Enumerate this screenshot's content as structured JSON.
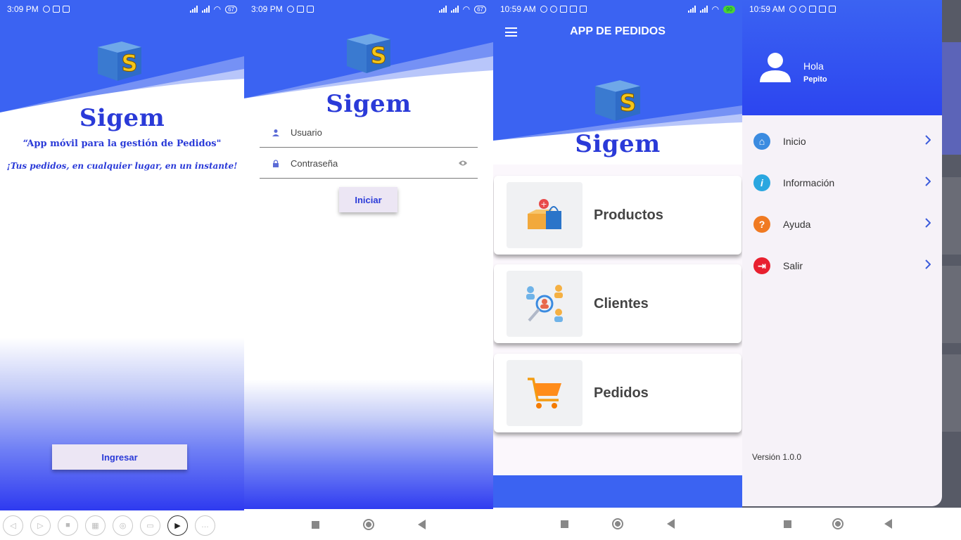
{
  "screen1": {
    "status": {
      "time": "3:09 PM",
      "battery": "67"
    },
    "brand": "Sigem",
    "tagline": "“App móvil para la gestión de Pedidos\"",
    "slogan": "¡Tus pedidos, en cualquier  lugar, en un instante!",
    "button": "Ingresar",
    "toolbar_icons": [
      "back-icon",
      "forward-icon",
      "pen-off-icon",
      "layers-icon",
      "zoom-icon",
      "keyboard-icon",
      "video-icon",
      "more-icon"
    ]
  },
  "screen2": {
    "status": {
      "time": "3:09 PM",
      "battery": "67"
    },
    "brand": "Sigem",
    "username_label": "Usuario",
    "password_label": "Contraseña",
    "button": "Iniciar"
  },
  "screen3": {
    "status": {
      "time": "10:59 AM",
      "battery": "90"
    },
    "appbar_title": "APP DE PEDIDOS",
    "brand": "Sigem",
    "cards": [
      {
        "label": "Productos",
        "icon": "shopping-box-icon"
      },
      {
        "label": "Clientes",
        "icon": "customer-search-icon"
      },
      {
        "label": "Pedidos",
        "icon": "shopping-cart-icon"
      }
    ]
  },
  "screen4": {
    "status": {
      "time": "10:59 AM"
    },
    "greeting": "Hola",
    "username": "Pepito",
    "menu": [
      {
        "label": "Inicio",
        "icon": "home-icon",
        "color": "#3b8be0"
      },
      {
        "label": "Información",
        "icon": "info-icon",
        "color": "#2aa7e0"
      },
      {
        "label": "Ayuda",
        "icon": "help-icon",
        "color": "#f07a22"
      },
      {
        "label": "Salir",
        "icon": "logout-icon",
        "color": "#e8202f"
      }
    ],
    "version": "Versión 1.0.0"
  },
  "colors": {
    "primary": "#3b63f2",
    "brand_text": "#2a3ad8",
    "button_bg": "#ece6f4"
  }
}
